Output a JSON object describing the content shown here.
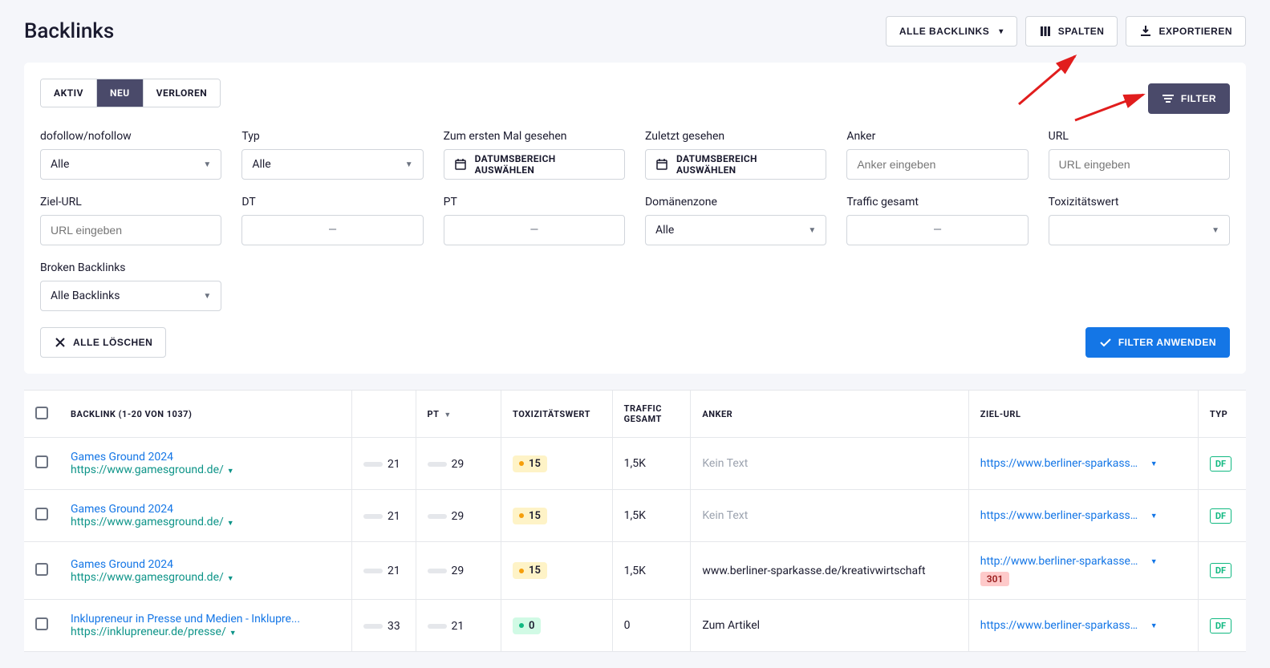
{
  "header": {
    "title": "Backlinks",
    "all_backlinks_btn": "ALLE BACKLINKS",
    "columns_btn": "SPALTEN",
    "export_btn": "EXPORTIEREN",
    "filter_btn": "FILTER"
  },
  "tabs": {
    "aktiv": "AKTIV",
    "neu": "NEU",
    "verloren": "VERLOREN",
    "active_index": 1
  },
  "filters": {
    "dofollow": {
      "label": "dofollow/nofollow",
      "value": "Alle"
    },
    "typ": {
      "label": "Typ",
      "value": "Alle"
    },
    "first_seen": {
      "label": "Zum ersten Mal gesehen",
      "button": "DATUMSBEREICH AUSWÄHLEN"
    },
    "last_seen": {
      "label": "Zuletzt gesehen",
      "button": "DATUMSBEREICH AUSWÄHLEN"
    },
    "anker": {
      "label": "Anker",
      "placeholder": "Anker eingeben"
    },
    "url": {
      "label": "URL",
      "placeholder": "URL eingeben"
    },
    "ziel_url": {
      "label": "Ziel-URL",
      "placeholder": "URL eingeben"
    },
    "dt": {
      "label": "DT",
      "value": "—"
    },
    "pt": {
      "label": "PT",
      "value": "—"
    },
    "domainzone": {
      "label": "Domänenzone",
      "value": "Alle"
    },
    "traffic": {
      "label": "Traffic gesamt",
      "value": "—"
    },
    "toxicity": {
      "label": "Toxizitätswert",
      "value": ""
    },
    "broken": {
      "label": "Broken Backlinks",
      "value": "Alle Backlinks"
    }
  },
  "actions": {
    "clear_all": "ALLE LÖSCHEN",
    "apply_filter": "FILTER ANWENDEN"
  },
  "table": {
    "headers": {
      "backlink": "BACKLINK (1-20 VON 1037)",
      "pt": "PT",
      "toxicity": "TOXIZITÄTSWERT",
      "traffic": "TRAFFIC GESAMT",
      "anker": "ANKER",
      "ziel_url": "ZIEL-URL",
      "typ": "TYP"
    },
    "rows": [
      {
        "title": "Games Ground 2024",
        "source_url": "https://www.gamesground.de/",
        "dt": "21",
        "pt": "29",
        "tox": "15",
        "tox_level": "yellow",
        "traffic": "1,5K",
        "anker": "Kein Text",
        "anker_muted": true,
        "ziel_url": "https://www.berliner-sparkasse.de/de...",
        "typ_badge": "DF",
        "redirect": ""
      },
      {
        "title": "Games Ground 2024",
        "source_url": "https://www.gamesground.de/",
        "dt": "21",
        "pt": "29",
        "tox": "15",
        "tox_level": "yellow",
        "traffic": "1,5K",
        "anker": "Kein Text",
        "anker_muted": true,
        "ziel_url": "https://www.berliner-sparkasse.de/de...",
        "typ_badge": "DF",
        "redirect": ""
      },
      {
        "title": "Games Ground 2024",
        "source_url": "https://www.gamesground.de/",
        "dt": "21",
        "pt": "29",
        "tox": "15",
        "tox_level": "yellow",
        "traffic": "1,5K",
        "anker": "www.berliner-sparkasse.de/kreativwirtschaft",
        "anker_muted": false,
        "ziel_url": "http://www.berliner-sparkasse.de/kre...",
        "typ_badge": "DF",
        "redirect": "301"
      },
      {
        "title": "Inklupreneur in Presse und Medien - Inklupre...",
        "source_url": "https://inklupreneur.de/presse/",
        "dt": "33",
        "pt": "21",
        "tox": "0",
        "tox_level": "green",
        "traffic": "0",
        "anker": "Zum Artikel",
        "anker_muted": false,
        "ziel_url": "https://www.berliner-sparkasse.de/de...",
        "typ_badge": "DF",
        "redirect": ""
      }
    ]
  }
}
